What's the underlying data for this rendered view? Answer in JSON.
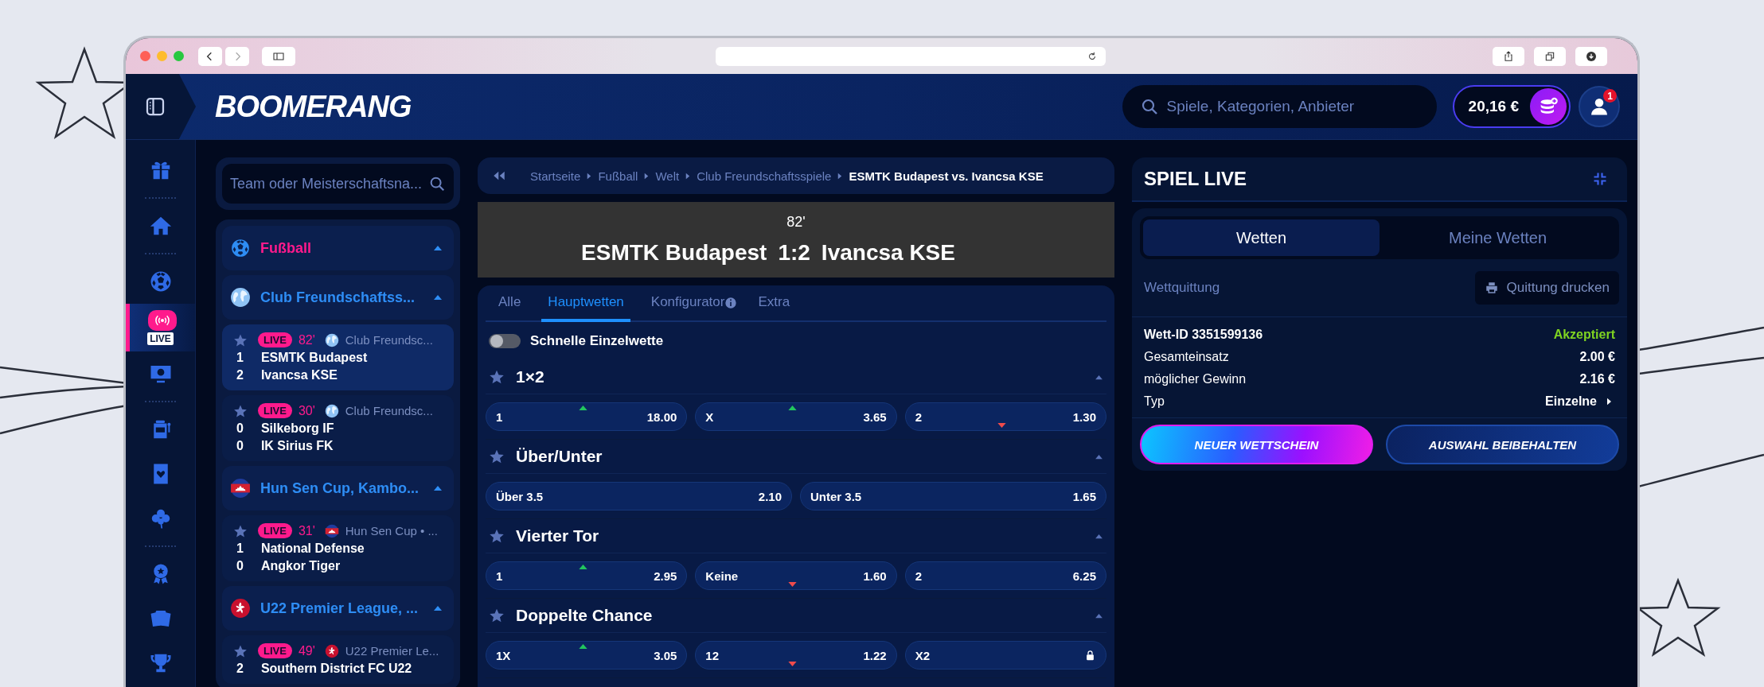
{
  "header": {
    "logo": "BOOMERANG",
    "search": {
      "placeholder": "Spiele, Kategorien, Anbieter"
    },
    "balance": "20,16 €",
    "notifications": "1"
  },
  "rail": [
    {
      "kind": "icon",
      "selected": false
    },
    {
      "kind": "divider"
    },
    {
      "kind": "icon",
      "selected": false
    },
    {
      "kind": "divider"
    },
    {
      "kind": "icon",
      "selected": false
    },
    {
      "kind": "icon",
      "label": "LIVE",
      "selected": true
    },
    {
      "kind": "icon",
      "selected": false
    },
    {
      "kind": "divider"
    },
    {
      "kind": "icon",
      "selected": false
    },
    {
      "kind": "icon",
      "selected": false
    },
    {
      "kind": "icon",
      "selected": false
    },
    {
      "kind": "divider"
    },
    {
      "kind": "icon",
      "selected": false
    },
    {
      "kind": "icon",
      "selected": false
    },
    {
      "kind": "icon",
      "selected": false
    }
  ],
  "sidebar": {
    "search": {
      "placeholder": "Team oder Meisterschaftsna..."
    },
    "sport": {
      "label": "Fußball",
      "expanded": true,
      "leagues": [
        {
          "name": "Club Freundschaftss...",
          "expanded": true,
          "matches": [
            {
              "badge": "LIVE",
              "minute": "82'",
              "league": "Club Freundsc...",
              "selected": true,
              "teams": [
                {
                  "score": "1",
                  "name": "ESMTK Budapest"
                },
                {
                  "score": "2",
                  "name": "Ivancsa KSE"
                }
              ]
            },
            {
              "badge": "LIVE",
              "minute": "30'",
              "league": "Club Freundsc...",
              "selected": false,
              "teams": [
                {
                  "score": "0",
                  "name": "Silkeborg IF"
                },
                {
                  "score": "0",
                  "name": "IK Sirius FK"
                }
              ]
            }
          ]
        },
        {
          "name": "Hun Sen Cup, Kambo...",
          "expanded": true,
          "matches": [
            {
              "badge": "LIVE",
              "minute": "31'",
              "league": "Hun Sen Cup • ...",
              "selected": false,
              "teams": [
                {
                  "score": "1",
                  "name": "National Defense"
                },
                {
                  "score": "0",
                  "name": "Angkor Tiger"
                }
              ]
            }
          ]
        },
        {
          "name": "U22 Premier League, ...",
          "expanded": true,
          "matches": [
            {
              "badge": "LIVE",
              "minute": "49'",
              "league": "U22 Premier Le...",
              "selected": false,
              "teams": [
                {
                  "score": "2",
                  "name": "Southern District FC U22"
                }
              ]
            }
          ]
        }
      ]
    }
  },
  "breadcrumb": [
    {
      "label": "Startseite",
      "current": false
    },
    {
      "label": "Fußball",
      "current": false
    },
    {
      "label": "Welt",
      "current": false
    },
    {
      "label": "Club Freundschaftsspiele",
      "current": false
    },
    {
      "label": "ESMTK Budapest vs. Ivancsa KSE",
      "current": true
    }
  ],
  "scoreboard": {
    "minute": "82'",
    "home": "ESMTK Budapest",
    "score": "1:2",
    "away": "Ivancsa KSE"
  },
  "market_tabs": [
    {
      "label": "Alle",
      "selected": false,
      "info": false
    },
    {
      "label": "Hauptwetten",
      "selected": true,
      "info": false
    },
    {
      "label": "Konfigurator",
      "selected": false,
      "info": true
    },
    {
      "label": "Extra",
      "selected": false,
      "info": false
    }
  ],
  "quick_bet": {
    "label": "Schnelle Einzelwette",
    "on": false
  },
  "markets": [
    {
      "title": "1×2",
      "expanded": true,
      "outcomes": [
        {
          "label": "1",
          "odds": "18.00",
          "rising": true,
          "falling": false,
          "locked": false
        },
        {
          "label": "X",
          "odds": "3.65",
          "rising": true,
          "falling": false,
          "locked": false
        },
        {
          "label": "2",
          "odds": "1.30",
          "rising": false,
          "falling": true,
          "locked": false
        }
      ]
    },
    {
      "title": "Über/Unter",
      "expanded": true,
      "outcomes": [
        {
          "label": "Über 3.5",
          "odds": "2.10",
          "rising": false,
          "falling": false,
          "locked": false
        },
        {
          "label": "Unter 3.5",
          "odds": "1.65",
          "rising": false,
          "falling": false,
          "locked": false
        }
      ]
    },
    {
      "title": "Vierter Tor",
      "expanded": true,
      "outcomes": [
        {
          "label": "1",
          "odds": "2.95",
          "rising": true,
          "falling": false,
          "locked": false
        },
        {
          "label": "Keine",
          "odds": "1.60",
          "rising": false,
          "falling": true,
          "locked": false
        },
        {
          "label": "2",
          "odds": "6.25",
          "rising": false,
          "falling": false,
          "locked": false
        }
      ]
    },
    {
      "title": "Doppelte Chance",
      "expanded": true,
      "outcomes": [
        {
          "label": "1X",
          "odds": "3.05",
          "rising": true,
          "falling": false,
          "locked": false
        },
        {
          "label": "12",
          "odds": "1.22",
          "rising": false,
          "falling": true,
          "locked": false
        },
        {
          "label": "X2",
          "rising": false,
          "falling": false,
          "locked": true
        }
      ]
    }
  ],
  "betslip": {
    "title": "SPIEL LIVE",
    "tabs": [
      {
        "label": "Wetten",
        "selected": true
      },
      {
        "label": "Meine Wetten",
        "selected": false
      }
    ],
    "receipt_label": "Wettquittung",
    "print_button": "Quittung drucken",
    "bet_id": "Wett-ID 3351599136",
    "status": "Akzeptiert",
    "rows": [
      {
        "label": "Gesamteinsatz",
        "value": "2.00 €",
        "link": false
      },
      {
        "label": "möglicher Gewinn",
        "value": "2.16 €",
        "link": false
      },
      {
        "label": "Typ",
        "value": "Einzelne",
        "link": true
      }
    ],
    "buttons": [
      "NEUER WETTSCHEIN",
      "AUSWAHL BEIBEHALTEN"
    ]
  }
}
